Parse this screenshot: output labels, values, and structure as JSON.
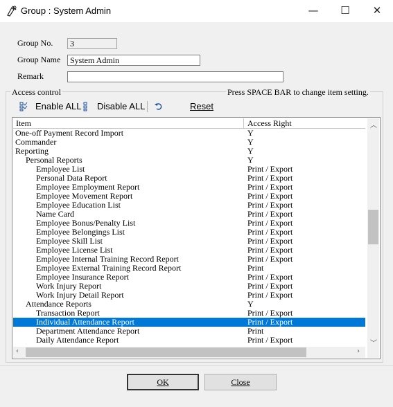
{
  "window": {
    "title": "Group : System Admin",
    "minimize": "—",
    "maximize": "☐",
    "close": "✕"
  },
  "form": {
    "group_no_label": "Group No.",
    "group_no_value": "3",
    "group_name_label": "Group Name",
    "group_name_value": "System Admin",
    "remark_label": "Remark",
    "remark_value": ""
  },
  "access_control": {
    "title": "Access control",
    "hint": "Press SPACE BAR to change item setting.",
    "toolbar": {
      "enable_all": "Enable ALL",
      "disable_all": "Disable ALL",
      "reset": "Reset"
    },
    "columns": {
      "item": "Item",
      "access": "Access Right"
    },
    "rows": [
      {
        "indent": 0,
        "item": "One-off Payment Record Import",
        "access": "Y"
      },
      {
        "indent": 0,
        "item": "Commander",
        "access": "Y"
      },
      {
        "indent": 0,
        "item": "Reporting",
        "access": "Y"
      },
      {
        "indent": 1,
        "item": "Personal Reports",
        "access": "Y"
      },
      {
        "indent": 2,
        "item": "Employee List",
        "access": "Print / Export"
      },
      {
        "indent": 2,
        "item": "Personal Data Report",
        "access": "Print / Export"
      },
      {
        "indent": 2,
        "item": "Employee Employment Report",
        "access": "Print / Export"
      },
      {
        "indent": 2,
        "item": "Employee Movement Report",
        "access": "Print / Export"
      },
      {
        "indent": 2,
        "item": "Employee Education List",
        "access": "Print / Export"
      },
      {
        "indent": 2,
        "item": "Name Card",
        "access": "Print / Export"
      },
      {
        "indent": 2,
        "item": "Employee Bonus/Penalty List",
        "access": "Print / Export"
      },
      {
        "indent": 2,
        "item": "Employee Belongings List",
        "access": "Print / Export"
      },
      {
        "indent": 2,
        "item": "Employee Skill List",
        "access": "Print / Export"
      },
      {
        "indent": 2,
        "item": "Employee License List",
        "access": "Print / Export"
      },
      {
        "indent": 2,
        "item": "Employee Internal Training Record Report",
        "access": "Print / Export"
      },
      {
        "indent": 2,
        "item": "Employee External Training Record Report",
        "access": "Print"
      },
      {
        "indent": 2,
        "item": "Employee Insurance Report",
        "access": "Print / Export"
      },
      {
        "indent": 2,
        "item": "Work Injury Report",
        "access": "Print / Export"
      },
      {
        "indent": 2,
        "item": "Work Injury Detail Report",
        "access": "Print / Export"
      },
      {
        "indent": 1,
        "item": "Attendance Reports",
        "access": "Y"
      },
      {
        "indent": 2,
        "item": "Transaction Report",
        "access": "Print / Export"
      },
      {
        "indent": 2,
        "item": "Individual Attendance Report",
        "access": "Print / Export",
        "selected": true
      },
      {
        "indent": 2,
        "item": "Department Attendance Report",
        "access": "Print"
      },
      {
        "indent": 2,
        "item": "Daily Attendance Report",
        "access": "Print / Export"
      }
    ]
  },
  "buttons": {
    "ok": "OK",
    "close": "Close"
  }
}
